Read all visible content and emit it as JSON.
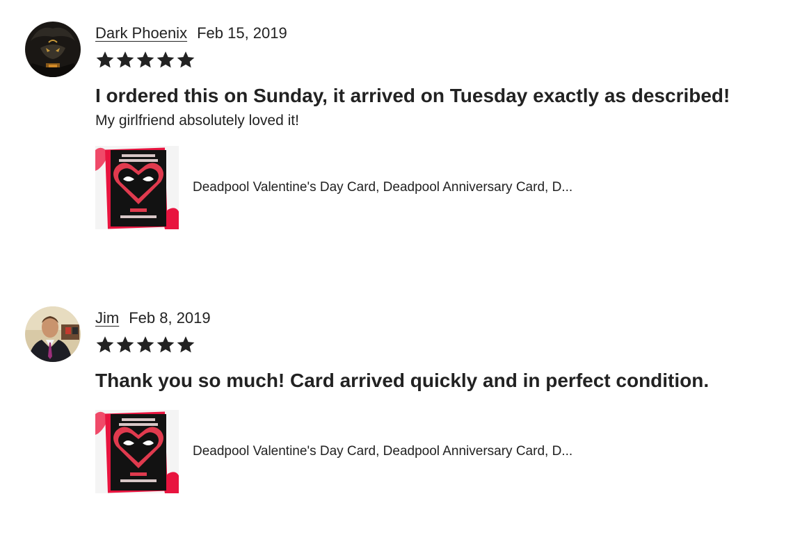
{
  "colors": {
    "text": "#222222",
    "star": "#222222",
    "card_black": "#111111",
    "card_red": "#e8143f",
    "card_accent": "#f04a69"
  },
  "reviews": [
    {
      "reviewer": "Dark Phoenix",
      "date": "Feb 15, 2019",
      "rating": 5,
      "headline": "I ordered this on Sunday, it arrived on Tuesday exactly as described!",
      "body": "My girlfriend absolutely loved it!",
      "item": {
        "title": "Deadpool Valentine's Day Card, Deadpool Anniversary Card, D..."
      }
    },
    {
      "reviewer": "Jim",
      "date": "Feb 8, 2019",
      "rating": 5,
      "headline": "Thank you so much! Card arrived quickly and in perfect condition.",
      "body": "",
      "item": {
        "title": "Deadpool Valentine's Day Card, Deadpool Anniversary Card, D..."
      }
    }
  ]
}
